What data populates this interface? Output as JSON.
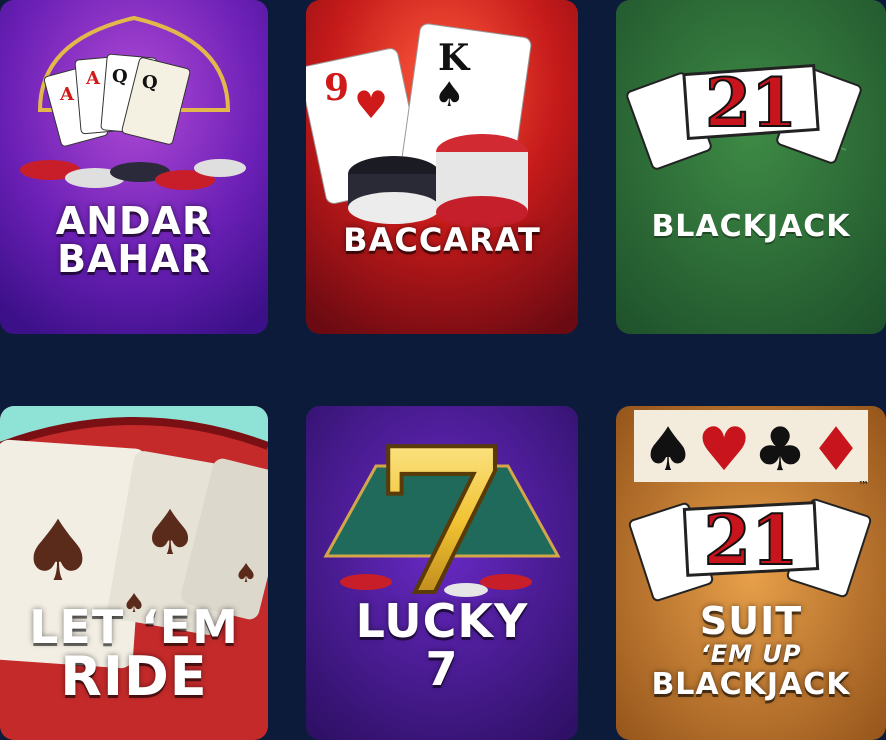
{
  "games": [
    {
      "title_line1": "ANDAR",
      "title_line2": "BAHAR"
    },
    {
      "title": "BACCARAT",
      "card1_rank": "9",
      "card2_rank": "K"
    },
    {
      "title": "BLACKJACK",
      "logo": "21"
    },
    {
      "title_line1": "LET ‘EM",
      "title_line2": "RIDE"
    },
    {
      "title_line1": "LUCKY",
      "title_line2": "7",
      "logo": "7"
    },
    {
      "logo": "21",
      "title_line1": "SUIT",
      "title_line2": "‘EM UP",
      "title_line3": "BLACKJACK",
      "trademark": "™"
    }
  ]
}
